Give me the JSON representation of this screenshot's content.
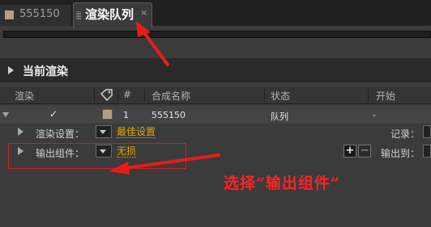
{
  "tabs": [
    {
      "label": "555150"
    },
    {
      "label": "渲染队列",
      "close": "×"
    }
  ],
  "section": {
    "title": "当前渲染"
  },
  "columns": {
    "render": "渲染",
    "num": "#",
    "comp_name": "合成名称",
    "status": "状态",
    "start": "开始"
  },
  "row": {
    "checked": "✓",
    "number": "1",
    "comp_name": "555150",
    "status": "队列",
    "start": "-"
  },
  "render_settings": {
    "label": "渲染设置：",
    "value": "最佳设置",
    "log_label": "记录："
  },
  "output_module": {
    "label": "输出组件：",
    "value": "无损",
    "output_to_label": "输出到：",
    "plus": "+",
    "minus": "−"
  },
  "annotation": {
    "text": "选择“输出组件”"
  },
  "colors": {
    "annotation": "#ff2222",
    "link": "#e0a800",
    "swatch": "#b59f82"
  }
}
